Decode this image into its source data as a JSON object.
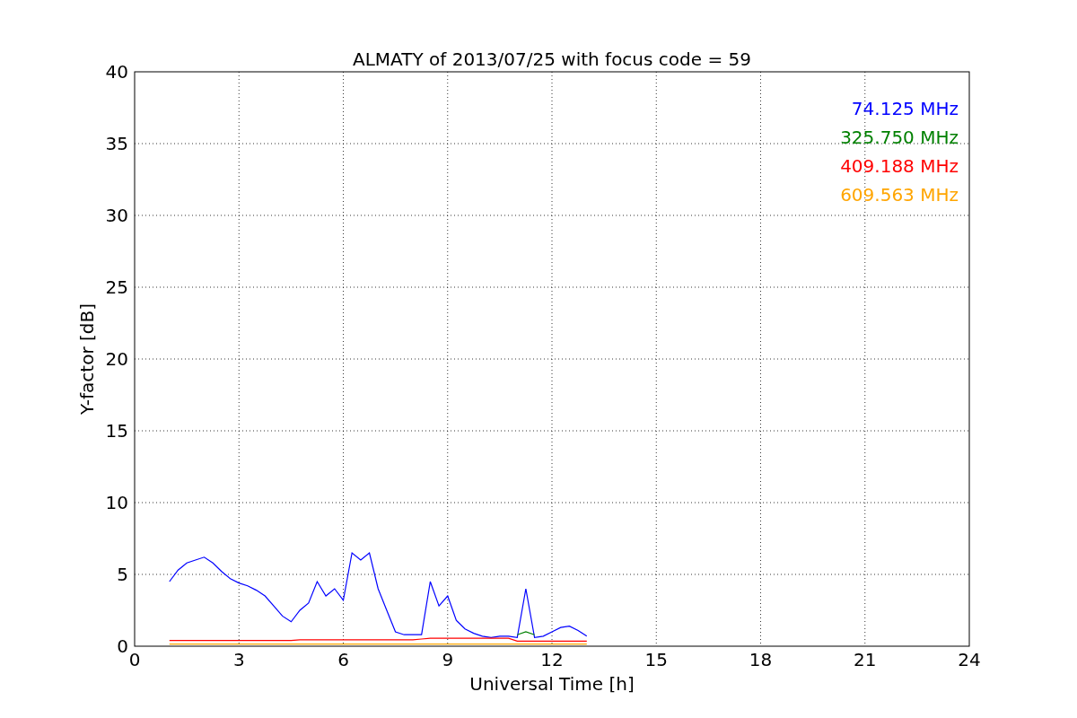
{
  "chart_data": {
    "type": "line",
    "title": "ALMATY of 2013/07/25 with focus code = 59",
    "xlabel": "Universal Time [h]",
    "ylabel": "Y-factor [dB]",
    "grid": true,
    "x": [
      1,
      1.25,
      1.5,
      1.75,
      2,
      2.25,
      2.5,
      2.75,
      3,
      3.25,
      3.5,
      3.75,
      4,
      4.25,
      4.5,
      4.75,
      5,
      5.25,
      5.5,
      5.75,
      6,
      6.25,
      6.5,
      6.75,
      7,
      7.25,
      7.5,
      7.75,
      8,
      8.25,
      8.5,
      8.75,
      9,
      9.25,
      9.5,
      9.75,
      10,
      10.25,
      10.5,
      10.75,
      11,
      11.25,
      11.5,
      11.75,
      12,
      12.25,
      12.5,
      12.75,
      13
    ],
    "series": [
      {
        "name": "74.125 MHz",
        "color": "#0000ff",
        "values": [
          4.5,
          5.3,
          5.8,
          6.0,
          6.2,
          5.8,
          5.2,
          4.7,
          4.4,
          4.2,
          3.9,
          3.5,
          2.8,
          2.1,
          1.7,
          2.5,
          3.0,
          4.5,
          3.5,
          4.0,
          3.2,
          6.5,
          6.0,
          6.5,
          4.0,
          2.5,
          1.0,
          0.8,
          0.8,
          0.8,
          4.5,
          2.8,
          3.5,
          1.8,
          1.2,
          0.9,
          0.7,
          0.6,
          0.7,
          0.7,
          0.6,
          4.0,
          0.6,
          0.7,
          1.0,
          1.3,
          1.4,
          1.1,
          0.7
        ]
      },
      {
        "name": "325.750 MHz",
        "color": "#008000",
        "values": [
          null,
          null,
          null,
          null,
          null,
          null,
          null,
          null,
          null,
          null,
          null,
          null,
          null,
          null,
          null,
          null,
          null,
          null,
          null,
          null,
          null,
          null,
          null,
          null,
          null,
          null,
          null,
          null,
          null,
          null,
          null,
          null,
          null,
          null,
          null,
          null,
          null,
          null,
          null,
          null,
          0.8,
          1.0,
          0.8,
          null,
          null,
          null,
          null,
          null,
          null
        ]
      },
      {
        "name": "409.188 MHz",
        "color": "#ff0000",
        "values": [
          0.4,
          0.4,
          0.4,
          0.4,
          0.4,
          0.4,
          0.4,
          0.4,
          0.4,
          0.4,
          0.4,
          0.4,
          0.4,
          0.4,
          0.4,
          0.45,
          0.45,
          0.45,
          0.45,
          0.45,
          0.45,
          0.45,
          0.45,
          0.45,
          0.45,
          0.45,
          0.45,
          0.45,
          0.45,
          0.5,
          0.55,
          0.55,
          0.55,
          0.55,
          0.55,
          0.55,
          0.55,
          0.55,
          0.55,
          0.55,
          0.35,
          0.35,
          0.35,
          0.35,
          0.35,
          0.35,
          0.35,
          0.35,
          0.35
        ]
      },
      {
        "name": "609.563 MHz",
        "color": "#ffa500",
        "values": [
          0.15,
          0.15,
          0.15,
          0.15,
          0.15,
          0.15,
          0.15,
          0.15,
          0.15,
          0.15,
          0.15,
          0.15,
          0.15,
          0.15,
          0.15,
          0.15,
          0.15,
          0.15,
          0.15,
          0.15,
          0.15,
          0.15,
          0.15,
          0.15,
          0.15,
          0.15,
          0.15,
          0.15,
          0.15,
          0.15,
          0.15,
          0.15,
          0.15,
          0.15,
          0.15,
          0.15,
          0.15,
          0.15,
          0.15,
          0.15,
          0.15,
          0.15,
          0.15,
          0.15,
          0.15,
          0.15,
          0.15,
          0.15,
          0.15
        ]
      }
    ],
    "xlim": [
      0,
      24
    ],
    "ylim": [
      0,
      40
    ],
    "xticks": [
      0,
      3,
      6,
      9,
      12,
      15,
      18,
      21,
      24
    ],
    "yticks": [
      0,
      5,
      10,
      15,
      20,
      25,
      30,
      35,
      40
    ]
  }
}
